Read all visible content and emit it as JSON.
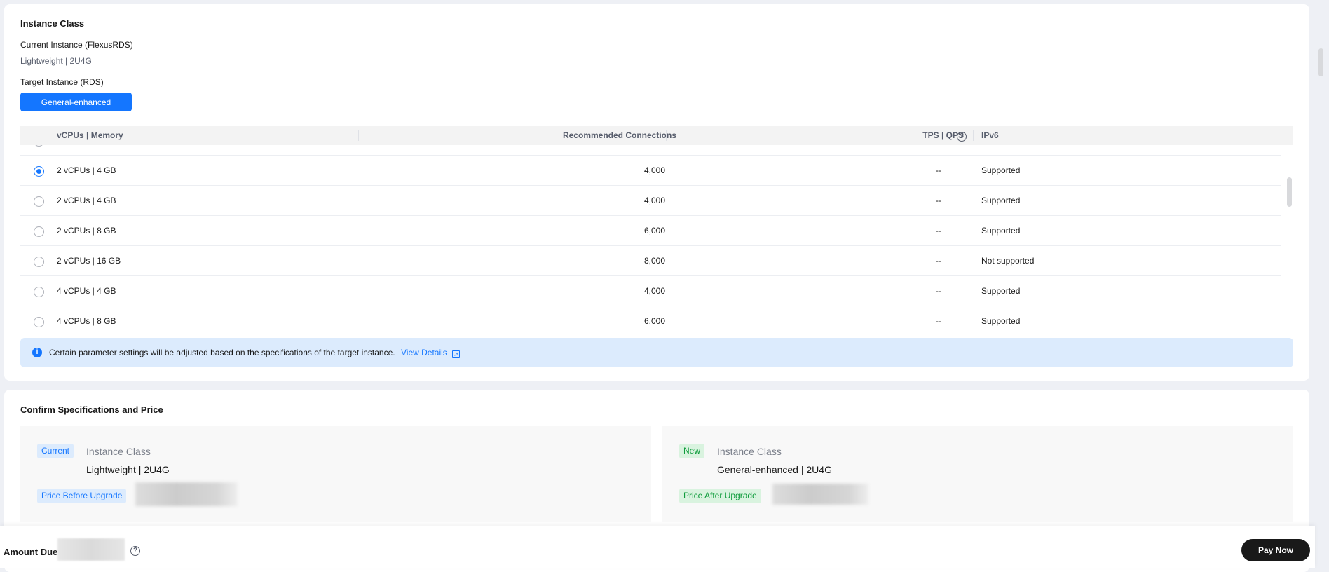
{
  "instance_class": {
    "title": "Instance Class",
    "current_label": "Current Instance (FlexusRDS)",
    "current_value": "Lightweight | 2U4G",
    "target_label": "Target Instance (RDS)",
    "target_type_button": "General-enhanced",
    "table": {
      "headers": {
        "spec": "vCPUs | Memory",
        "connections": "Recommended Connections",
        "tps_qps": "TPS | QPS",
        "ipv6": "IPv6"
      },
      "rows": [
        {
          "spec": "2 vCPUs | 4 GB",
          "connections": "4,000",
          "tps_qps": "--",
          "ipv6": "Supported",
          "selected": true
        },
        {
          "spec": "2 vCPUs | 4 GB",
          "connections": "4,000",
          "tps_qps": "--",
          "ipv6": "Supported",
          "selected": false
        },
        {
          "spec": "2 vCPUs | 8 GB",
          "connections": "6,000",
          "tps_qps": "--",
          "ipv6": "Supported",
          "selected": false
        },
        {
          "spec": "2 vCPUs | 16 GB",
          "connections": "8,000",
          "tps_qps": "--",
          "ipv6": "Not supported",
          "selected": false
        },
        {
          "spec": "4 vCPUs | 4 GB",
          "connections": "4,000",
          "tps_qps": "--",
          "ipv6": "Supported",
          "selected": false
        },
        {
          "spec": "4 vCPUs | 8 GB",
          "connections": "6,000",
          "tps_qps": "--",
          "ipv6": "Supported",
          "selected": false
        }
      ]
    },
    "notice": {
      "text": "Certain parameter settings will be adjusted based on the specifications of the target instance.",
      "link": "View Details"
    }
  },
  "confirm": {
    "title": "Confirm Specifications and Price",
    "current": {
      "tag": "Current",
      "label": "Instance Class",
      "value": "Lightweight | 2U4G",
      "price_tag": "Price Before Upgrade"
    },
    "new": {
      "tag": "New",
      "label": "Instance Class",
      "value": "General-enhanced | 2U4G",
      "price_tag": "Price After Upgrade"
    }
  },
  "footer": {
    "amount_label": "Amount Due",
    "pay_button": "Pay Now"
  },
  "colors": {
    "accent": "#1476ff",
    "success": "#0d9b3a",
    "notice_bg": "#dcebfd"
  }
}
